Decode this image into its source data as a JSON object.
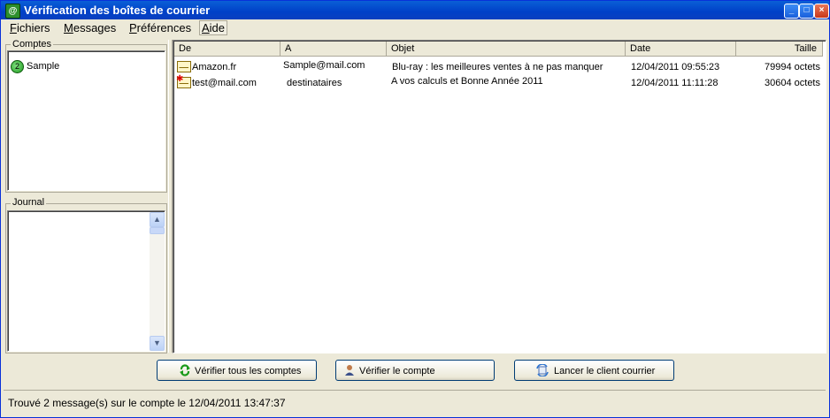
{
  "window": {
    "title": "Vérification des boîtes de courrier"
  },
  "menu": {
    "items": [
      {
        "label": "Fichiers"
      },
      {
        "label": "Messages"
      },
      {
        "label": "Préférences"
      },
      {
        "label": "Aide"
      }
    ]
  },
  "accounts_panel": {
    "title": "Comptes",
    "accounts": [
      {
        "name": "Sample",
        "badge": "2"
      }
    ]
  },
  "journal_panel": {
    "title": "Journal"
  },
  "messages": {
    "columns": [
      {
        "label": "De"
      },
      {
        "label": "A"
      },
      {
        "label": "Objet"
      },
      {
        "label": "Date"
      },
      {
        "label": "Taille"
      }
    ],
    "rows": [
      {
        "from": "Amazon.fr",
        "to": "Sample@mail.com",
        "subject": "Blu-ray : les meilleures ventes à ne pas manquer",
        "date": "12/04/2011 09:55:23",
        "size": "79994 octets"
      },
      {
        "from": "test@mail.com",
        "to": "destinataires",
        "subject": "A vos calculs et Bonne Année 2011",
        "date": "12/04/2011 11:11:28",
        "size": "30604 octets"
      }
    ]
  },
  "buttons": {
    "check_all": "Vérifier tous les comptes",
    "check_one": "Vérifier le compte",
    "launch_client": "Lancer le client courrier"
  },
  "status": {
    "text": "Trouvé 2 message(s) sur le compte  le 12/04/2011 13:47:37"
  }
}
